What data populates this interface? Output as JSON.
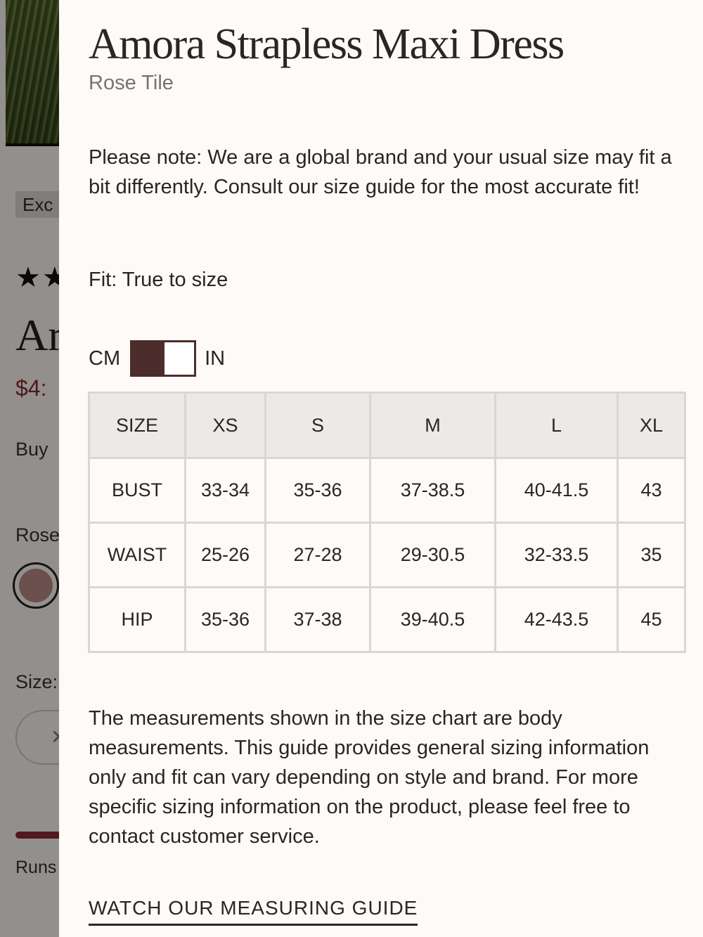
{
  "background_page": {
    "badge_text": "Exc",
    "rating_stars": "★★",
    "title_fragment": "Ar",
    "price_fragment": "$4:",
    "buy_fragment": "Buy",
    "color_fragment": "Rose",
    "size_label_fragment": "Size:",
    "size_button_fragment": "✕",
    "runs_fragment": "Runs"
  },
  "drawer": {
    "product_title": "Amora Strapless Maxi Dress",
    "product_color": "Rose Tile",
    "note": "Please note: We are a global brand and your usual size may fit a bit differently. Consult our size guide for the most accurate fit!",
    "fit": "Fit: True to size",
    "units": {
      "cm": "CM",
      "in": "IN",
      "selected": "IN"
    },
    "size_chart": {
      "headers": [
        "SIZE",
        "XS",
        "S",
        "M",
        "L",
        "XL"
      ],
      "rows": [
        {
          "label": "BUST",
          "values": [
            "33-34",
            "35-36",
            "37-38.5",
            "40-41.5",
            "43"
          ]
        },
        {
          "label": "WAIST",
          "values": [
            "25-26",
            "27-28",
            "29-30.5",
            "32-33.5",
            "35"
          ]
        },
        {
          "label": "HIP",
          "values": [
            "35-36",
            "37-38",
            "39-40.5",
            "42-43.5",
            "45"
          ]
        }
      ]
    },
    "disclaimer": "The measurements shown in the size chart are body measurements. This guide provides general sizing information only and fit can vary depending on style and brand. For more specific sizing information on the product, please feel free to contact customer service.",
    "measuring_link": "WATCH OUR MEASURING GUIDE"
  },
  "colors": {
    "accent_dark": "#4b2e2b",
    "text": "#2b2523",
    "price_red": "#8a2a2a",
    "swatch_rose": "#b88a85"
  }
}
